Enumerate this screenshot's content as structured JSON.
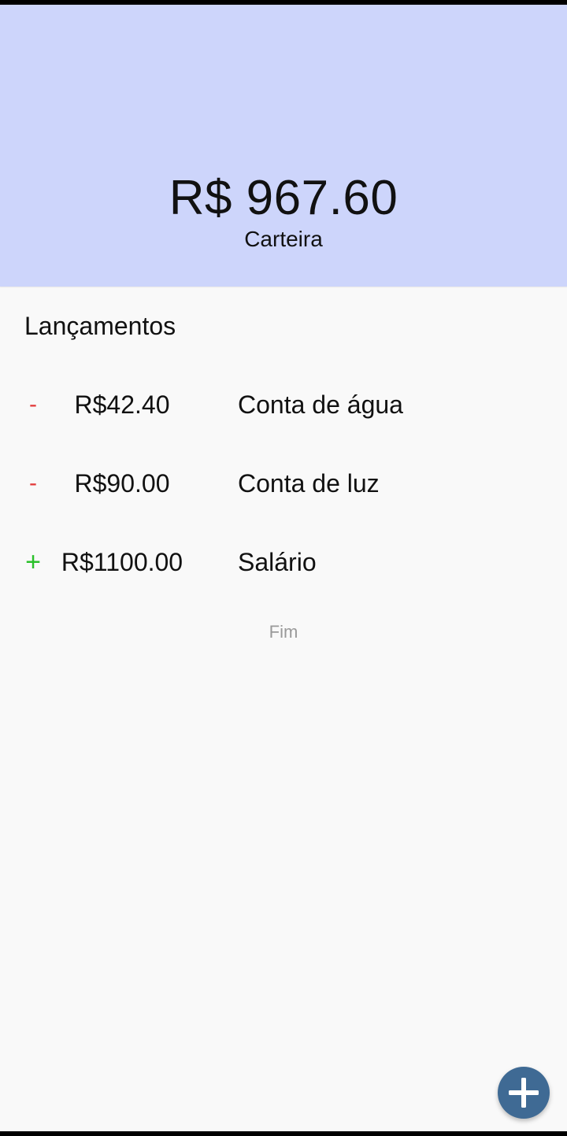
{
  "header": {
    "balance": "R$ 967.60",
    "wallet_label": "Carteira",
    "background_color": "#cdd5fb"
  },
  "section_title": "Lançamentos",
  "transactions": [
    {
      "sign": "-",
      "type": "expense",
      "amount": "R$42.40",
      "description": "Conta de água"
    },
    {
      "sign": "-",
      "type": "expense",
      "amount": "R$90.00",
      "description": "Conta de luz"
    },
    {
      "sign": "+",
      "type": "income",
      "amount": "R$1100.00",
      "description": "Salário"
    }
  ],
  "end_label": "Fim",
  "fab": {
    "icon": "plus-icon",
    "color": "#3f6a94"
  },
  "colors": {
    "expense": "#e23b3b",
    "income": "#2ac02a"
  }
}
